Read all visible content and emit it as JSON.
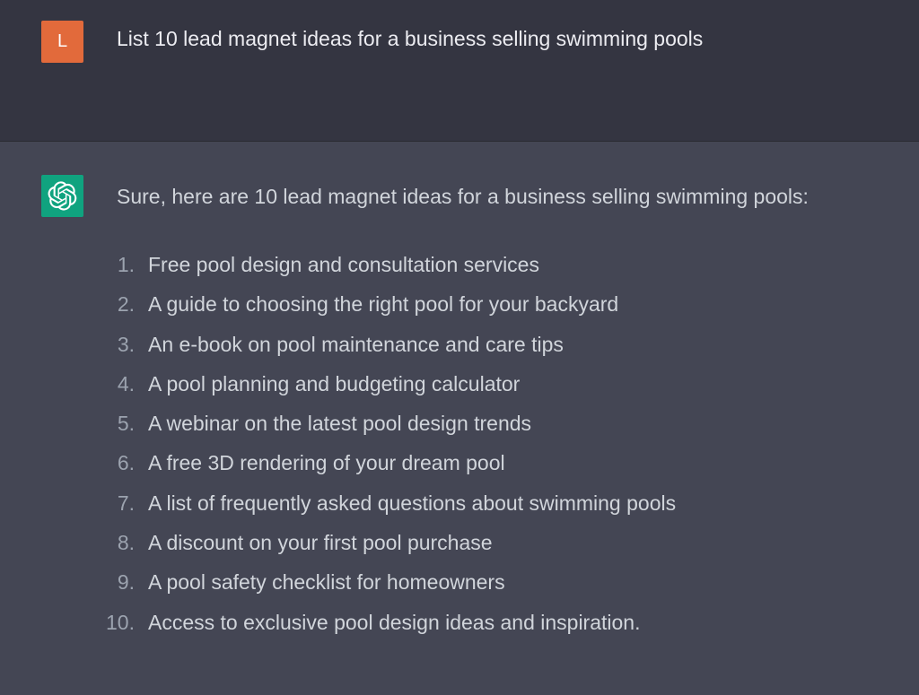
{
  "user_turn": {
    "avatar_letter": "L",
    "message": "List 10 lead magnet ideas for a business selling swimming pools"
  },
  "assistant_turn": {
    "avatar_icon": "openai-logo-icon",
    "intro": "Sure, here are 10 lead magnet ideas for a business selling swimming pools:",
    "items": [
      {
        "number": "1.",
        "text": "Free pool design and consultation services"
      },
      {
        "number": "2.",
        "text": "A guide to choosing the right pool for your backyard"
      },
      {
        "number": "3.",
        "text": "An e-book on pool maintenance and care tips"
      },
      {
        "number": "4.",
        "text": "A pool planning and budgeting calculator"
      },
      {
        "number": "5.",
        "text": "A webinar on the latest pool design trends"
      },
      {
        "number": "6.",
        "text": "A free 3D rendering of your dream pool"
      },
      {
        "number": "7.",
        "text": "A list of frequently asked questions about swimming pools"
      },
      {
        "number": "8.",
        "text": "A discount on your first pool purchase"
      },
      {
        "number": "9.",
        "text": "A pool safety checklist for homeowners"
      },
      {
        "number": "10.",
        "text": "Access to exclusive pool design ideas and inspiration."
      }
    ]
  },
  "colors": {
    "user_bg": "#343541",
    "assistant_bg": "#444654",
    "user_avatar": "#e26a3b",
    "assistant_avatar": "#10a37f"
  }
}
